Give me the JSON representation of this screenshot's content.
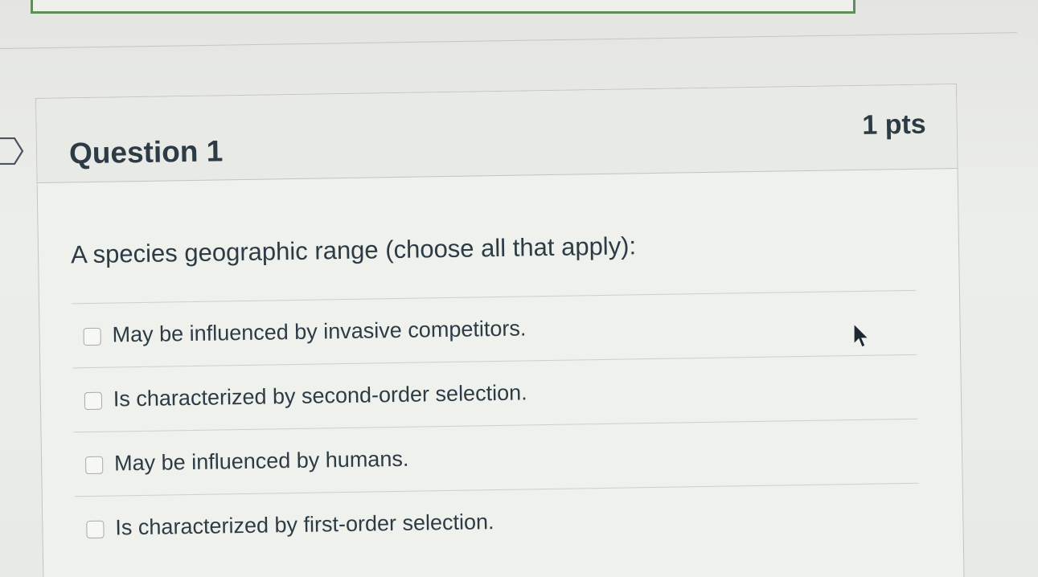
{
  "question": {
    "title": "Question 1",
    "points": "1 pts",
    "prompt": "A species geographic range (choose all that apply):",
    "answers": [
      {
        "label": "May be influenced by invasive competitors.",
        "checked": false
      },
      {
        "label": "Is characterized by second-order selection.",
        "checked": false
      },
      {
        "label": "May be influenced by humans.",
        "checked": false
      },
      {
        "label": "Is characterized by first-order selection.",
        "checked": false
      }
    ]
  },
  "icons": {
    "flag": "flag-marker-icon",
    "cursor": "mouse-pointer-icon"
  },
  "colors": {
    "text": "#2d3b45",
    "border": "#c1c5c0",
    "accent": "#5e8f5a"
  }
}
